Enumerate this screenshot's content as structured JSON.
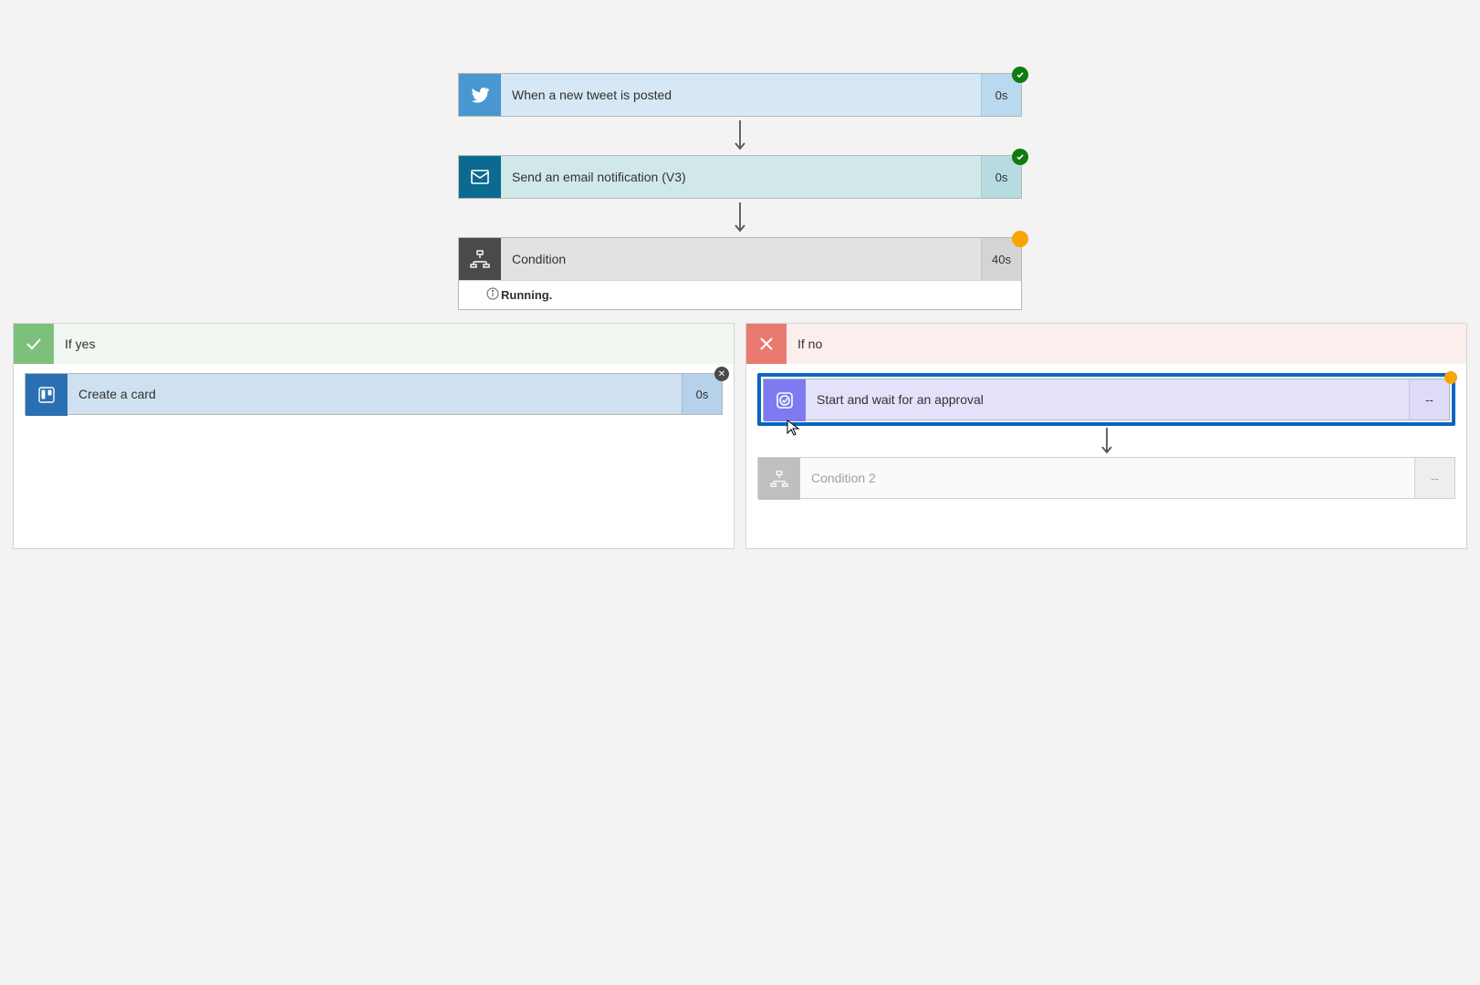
{
  "steps": {
    "twitter": {
      "label": "When a new tweet is posted",
      "duration": "0s"
    },
    "mail": {
      "label": "Send an email notification (V3)",
      "duration": "0s"
    },
    "condition": {
      "label": "Condition",
      "duration": "40s",
      "status": "Running."
    }
  },
  "branches": {
    "yes": {
      "title": "If yes",
      "trello": {
        "label": "Create a card",
        "duration": "0s"
      }
    },
    "no": {
      "title": "If no",
      "approval": {
        "label": "Start and wait for an approval",
        "duration": "--"
      },
      "condition2": {
        "label": "Condition 2",
        "duration": "--"
      }
    }
  }
}
